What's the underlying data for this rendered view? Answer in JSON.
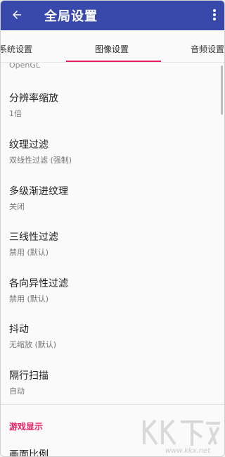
{
  "appbar": {
    "title": "全局设置",
    "back_icon": "arrow-left-icon",
    "more_icon": "more-vert-icon",
    "color": "#3949ab"
  },
  "tabs": [
    {
      "label": "系统设置"
    },
    {
      "label": "图像设置",
      "active": true
    },
    {
      "label": "音频设置"
    }
  ],
  "accent": "#e91e63",
  "list": {
    "partial_top": "OpenGL",
    "items": [
      {
        "label": "分辨率缩放",
        "value": "1倍"
      },
      {
        "label": "纹理过滤",
        "value": "双线性过滤 (强制)"
      },
      {
        "label": "多级渐进纹理",
        "value": "关闭"
      },
      {
        "label": "三线性过滤",
        "value": "禁用 (默认)"
      },
      {
        "label": "各向异性过滤",
        "value": "禁用 (默认)"
      },
      {
        "label": "抖动",
        "value": "无缩放 (默认)"
      },
      {
        "label": "隔行扫描",
        "value": "自动"
      }
    ],
    "section_title": "游戏显示",
    "cut_item": "画面比例"
  },
  "watermark": {
    "text": "KKX下载",
    "url": "www.kkx.net"
  }
}
